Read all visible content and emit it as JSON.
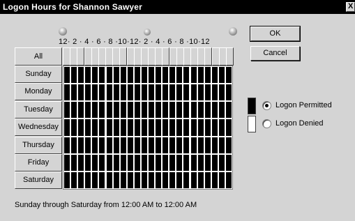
{
  "window": {
    "title": "Logon Hours for Shannon Sawyer",
    "close_glyph": "X"
  },
  "hour_scale": {
    "labels": "12· 2 · 4 · 6 · 8 ·10·12· 2 · 4 · 6 · 8 ·10·12",
    "icons": [
      "midnight-sun-icon",
      "noon-sun-icon",
      "midnight-sun-icon"
    ]
  },
  "buttons": {
    "ok": "OK",
    "cancel": "Cancel"
  },
  "grid": {
    "all_label": "All",
    "days": [
      "Sunday",
      "Monday",
      "Tuesday",
      "Wednesday",
      "Thursday",
      "Friday",
      "Saturday"
    ],
    "hours_per_day": 24,
    "permitted": "all"
  },
  "legend": {
    "permitted_label": "Logon Permitted",
    "denied_label": "Logon Denied",
    "selected": "permitted",
    "permitted_color": "#000000",
    "denied_color": "#ffffff"
  },
  "summary": "Sunday through Saturday from 12:00 AM to 12:00 AM"
}
